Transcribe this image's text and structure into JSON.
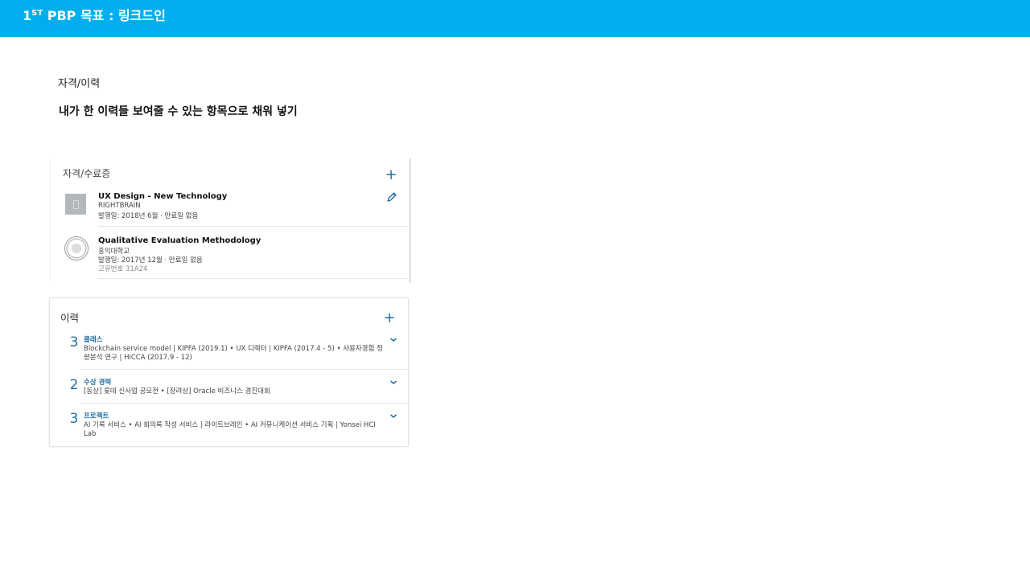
{
  "header": {
    "title_prefix": "1",
    "title_sup": "ST",
    "title_rest": " PBP 목표 : 링크드인"
  },
  "section": {
    "label": "자격/이력",
    "headline": "내가 한 이력들 보여줄 수 있는 항목으로 채워 넣기"
  },
  "certifications": {
    "title": "자격/수료증",
    "add_icon": "plus-icon",
    "edit_icon": "pencil-icon",
    "items": [
      {
        "name": "UX Design - New Technology",
        "issuer": "RIGHTBRAIN",
        "date": "발행일: 2018년 6월 · 만료일 없음"
      },
      {
        "name": "Qualitative Evaluation Methodology",
        "issuer": "홍익대학교",
        "date": "발행일: 2017년 12월 · 만료일 없음",
        "credential": "고유번호 31A24"
      }
    ]
  },
  "career": {
    "title": "이력",
    "add_icon": "plus-icon",
    "groups": [
      {
        "count": "3",
        "category": "클래스",
        "description": "Blockchain service model | KIPFA (2019.1)  • UX 디렉터 | KIPFA (2017.4 - 5)  • 사용자경험 정량분석 연구 | HiCCA (2017.9 - 12)"
      },
      {
        "count": "2",
        "category": "수상 경력",
        "description": "[동상] 롯데 신사업 공모전  • [장려상] Oracle 비즈니스 경진대회"
      },
      {
        "count": "3",
        "category": "프로젝트",
        "description": "AI 기록 서비스  • AI 회의록 작성 서비스 | 라이트브레인  • AI 커뮤니케이션 서비스 기획 | Yonsei HCI Lab"
      }
    ]
  },
  "colors": {
    "header_bg": "#00aeef",
    "accent": "#1f6fa6"
  }
}
